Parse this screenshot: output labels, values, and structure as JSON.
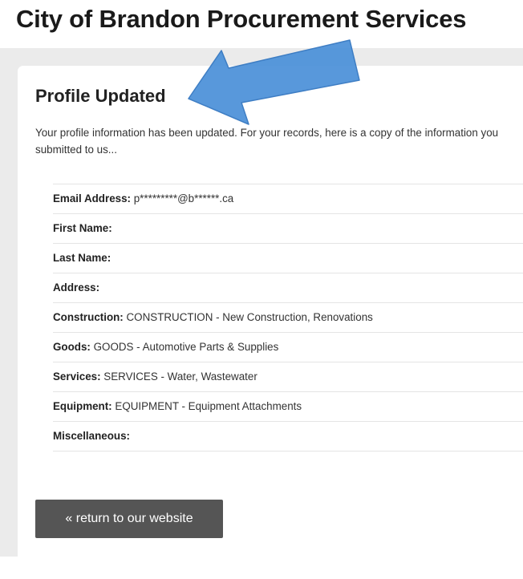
{
  "page": {
    "title": "City of Brandon Procurement Services"
  },
  "card": {
    "heading": "Profile Updated",
    "intro": "Your profile information has been updated. For your records, here is a copy of the information you submitted to us..."
  },
  "profile_fields": [
    {
      "label": "Email Address:",
      "value": "p*********@b******.ca"
    },
    {
      "label": "First Name:",
      "value": ""
    },
    {
      "label": "Last Name:",
      "value": ""
    },
    {
      "label": "Address:",
      "value": ""
    },
    {
      "label": "Construction:",
      "value": "CONSTRUCTION - New Construction, Renovations"
    },
    {
      "label": "Goods:",
      "value": "GOODS - Automotive Parts & Supplies"
    },
    {
      "label": "Services:",
      "value": "SERVICES - Water, Wastewater"
    },
    {
      "label": "Equipment:",
      "value": "EQUIPMENT - Equipment Attachments"
    },
    {
      "label": "Miscellaneous:",
      "value": ""
    }
  ],
  "actions": {
    "return_label": "« return to our website"
  },
  "colors": {
    "annotation_arrow": "#4a90d9",
    "page_background": "#ebebeb",
    "button": "#555555"
  },
  "icons": {
    "annotation": "arrow-annotation-icon"
  }
}
